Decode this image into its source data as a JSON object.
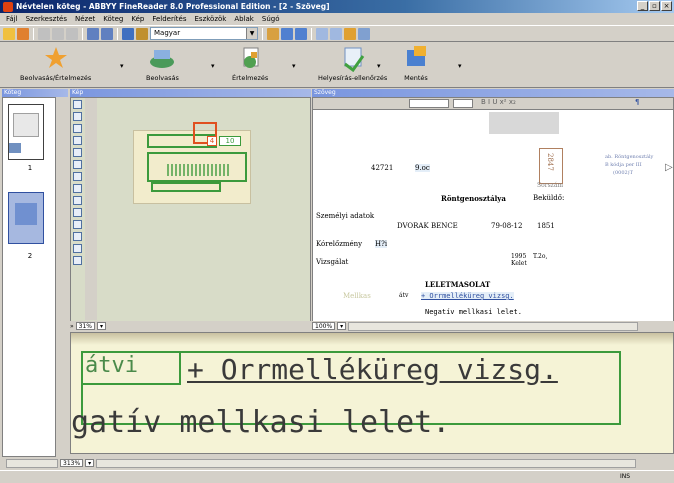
{
  "window": {
    "title": "Névtelen köteg - ABBYY FineReader 8.0 Professional Edition - [2 - Szöveg]",
    "controls": [
      "_",
      "▫",
      "×"
    ]
  },
  "menu": [
    "Fájl",
    "Szerkesztés",
    "Nézet",
    "Köteg",
    "Kép",
    "Felderítés",
    "Eszközök",
    "Ablak",
    "Súgó"
  ],
  "toolbar": {
    "language_value": "Magyar"
  },
  "big_toolbar": {
    "scan": "Beolvasás",
    "read": "Értelmezés",
    "spell": "Helyesírás-ellenőrzés",
    "save": "Mentés",
    "scan_read": "Beolvasás/Értelmezés"
  },
  "panes": {
    "batch_header": "Köteg",
    "image_header": "Kép",
    "text_header": "Szöveg"
  },
  "thumbnails": [
    {
      "number": "1"
    },
    {
      "number": "2"
    }
  ],
  "image_pane": {
    "zoom": "31%",
    "label_block": "4",
    "label_block2": "10"
  },
  "text_pane": {
    "zoom": "100%",
    "lines": {
      "id_number": "42721",
      "class": "9.oc",
      "stamp": "2847",
      "stamp_label": "Sorszám",
      "dept": "Röntgenosztálya",
      "sender": "Beküldő:",
      "personal": "Személyi adatok",
      "name": "DVORAK BENCE",
      "date": "79-08-12",
      "code": "1851",
      "history": "Kórelőzmény",
      "history_val": "H?i",
      "exam": "Vizsgálat",
      "exam_year": "1995",
      "exam_code": "T.2o,",
      "exam_status": "Kelet",
      "result_title": "LELETMASOLAT",
      "attach": "Mellkas",
      "atv": "átv",
      "sinus": "+ Orrmelléküreg vizsg.",
      "negative": "Negatív mellkasi lelet.",
      "side_note1": "ab. Röntgenosztály",
      "side_note2": "B kódja per III",
      "side_note3": "(0002)T"
    }
  },
  "zoom_pane": {
    "zoom": "313%",
    "line1": "átvi",
    "line1b": "+ Orrmelléküreg vizsg.",
    "line2": "gatív mellkasi lelet."
  },
  "status": {
    "mode": "INS"
  },
  "colors": {
    "title_bar": "#0a246a",
    "chrome": "#d4d0c8",
    "text_block": "#3c9a3c",
    "image_block": "#e05020"
  }
}
